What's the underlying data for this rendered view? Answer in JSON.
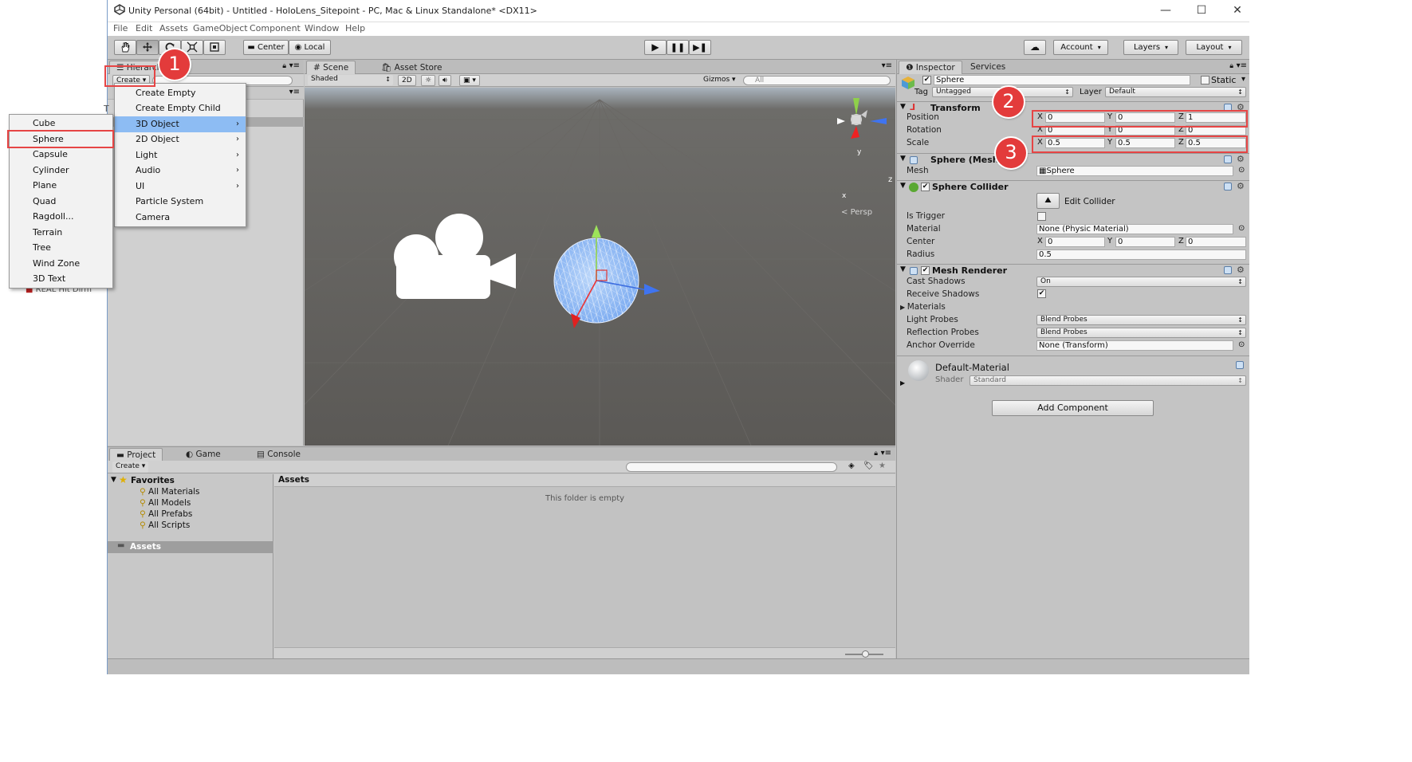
{
  "window": {
    "title": "Unity Personal (64bit) - Untitled - HoloLens_Sitepoint - PC, Mac & Linux Standalone* <DX11>",
    "minimize": "—",
    "maximize": "☐",
    "close": "✕"
  },
  "menubar": [
    "File",
    "Edit",
    "Assets",
    "GameObject",
    "Component",
    "Window",
    "Help"
  ],
  "toolbar": {
    "pivot": "Center",
    "space": "Local",
    "account": "Account",
    "layers": "Layers",
    "layout": "Layout"
  },
  "hierarchy": {
    "tab": "Hierarchy",
    "create": "Create",
    "partial_item": "REAL Hit Dirm"
  },
  "create_menu": {
    "items": [
      "Create Empty",
      "Create Empty Child",
      "3D Object",
      "2D Object",
      "Light",
      "Audio",
      "UI",
      "Particle System",
      "Camera"
    ],
    "highlighted": "3D Object"
  },
  "object_submenu": {
    "items": [
      "Cube",
      "Sphere",
      "Capsule",
      "Cylinder",
      "Plane",
      "Quad",
      "Ragdoll...",
      "Terrain",
      "Tree",
      "Wind Zone",
      "3D Text"
    ],
    "selected": "Sphere"
  },
  "scene": {
    "tabs": [
      "Scene",
      "Asset Store"
    ],
    "shading": "Shaded",
    "mode_2d": "2D",
    "gizmos": "Gizmos",
    "search_placeholder": "All",
    "persp": "Persp",
    "axis_y": "y",
    "axis_z": "z",
    "axis_x": "x"
  },
  "inspector": {
    "tabs": [
      "Inspector",
      "Services"
    ],
    "object_name": "Sphere",
    "static_label": "Static",
    "tag_label": "Tag",
    "tag_value": "Untagged",
    "layer_label": "Layer",
    "layer_value": "Default",
    "transform": {
      "title": "Transform",
      "position_label": "Position",
      "rotation_label": "Rotation",
      "scale_label": "Scale",
      "position": {
        "x": "0",
        "y": "0",
        "z": "1"
      },
      "rotation": {
        "x": "0",
        "y": "0",
        "z": "0"
      },
      "scale": {
        "x": "0.5",
        "y": "0.5",
        "z": "0.5"
      }
    },
    "mesh_filter": {
      "title": "Sphere (Mesh Filter)",
      "title_visible": "Sphere (Mesh",
      "mesh_label": "Mesh",
      "mesh_value": "Sphere"
    },
    "sphere_collider": {
      "title": "Sphere Collider",
      "edit_collider": "Edit Collider",
      "is_trigger_label": "Is Trigger",
      "material_label": "Material",
      "material_value": "None (Physic Material)",
      "center_label": "Center",
      "center": {
        "x": "0",
        "y": "0",
        "z": "0"
      },
      "radius_label": "Radius",
      "radius_value": "0.5"
    },
    "mesh_renderer": {
      "title": "Mesh Renderer",
      "cast_shadows_label": "Cast Shadows",
      "cast_shadows_value": "On",
      "receive_shadows_label": "Receive Shadows",
      "materials_label": "Materials",
      "light_probes_label": "Light Probes",
      "light_probes_value": "Blend Probes",
      "reflection_probes_label": "Reflection Probes",
      "reflection_probes_value": "Blend Probes",
      "anchor_override_label": "Anchor Override",
      "anchor_override_value": "None (Transform)"
    },
    "material": {
      "name": "Default-Material",
      "shader_label": "Shader",
      "shader_value": "Standard"
    },
    "add_component": "Add Component"
  },
  "project": {
    "tabs": [
      "Project",
      "Game",
      "Console"
    ],
    "create": "Create",
    "favorites": "Favorites",
    "favorite_items": [
      "All Materials",
      "All Models",
      "All Prefabs",
      "All Scripts"
    ],
    "assets_folder": "Assets",
    "assets_header": "Assets",
    "empty_message": "This folder is empty"
  },
  "markers": [
    "1",
    "2",
    "3"
  ],
  "colors": {
    "highlight": "#8dbcf3",
    "annotation_red": "#e33b3b",
    "scene_bg": "#5f5d5a",
    "panel_bg": "#c2c2c2"
  }
}
